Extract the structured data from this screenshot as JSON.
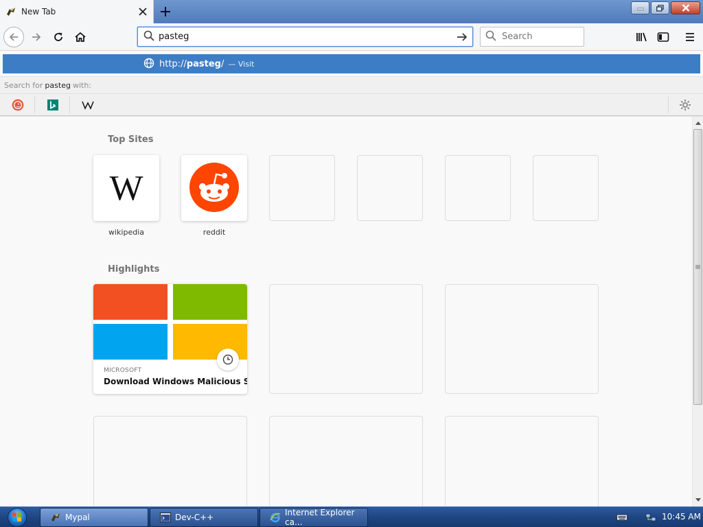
{
  "tab": {
    "title": "New Tab"
  },
  "urlbar": {
    "value": "pasteg"
  },
  "searchbar": {
    "placeholder": "Search"
  },
  "autocomplete": {
    "url_prefix": "http://",
    "url_bold": "pasteg",
    "url_suffix": "/",
    "action": "— Visit"
  },
  "search_with": {
    "prefix": "Search for",
    "query": "pasteg",
    "suffix": "with:"
  },
  "top_sites": {
    "title": "Top Sites",
    "tiles": [
      {
        "label": "wikipedia"
      },
      {
        "label": "reddit"
      }
    ]
  },
  "highlights": {
    "title": "Highlights",
    "cards": [
      {
        "host": "MICROSOFT",
        "title": "Download Windows Malicious So..."
      }
    ]
  },
  "taskbar": {
    "tasks": [
      {
        "label": "Mypal"
      },
      {
        "label": "Dev-C++"
      },
      {
        "label": "Internet Explorer ca..."
      }
    ],
    "time": "10:45 AM"
  },
  "colors": {
    "accent": "#3d7dc5",
    "reddit": "#ff4500",
    "ms_red": "#f25022",
    "ms_green": "#7fba00",
    "ms_blue": "#00a4ef",
    "ms_yellow": "#ffb900"
  }
}
